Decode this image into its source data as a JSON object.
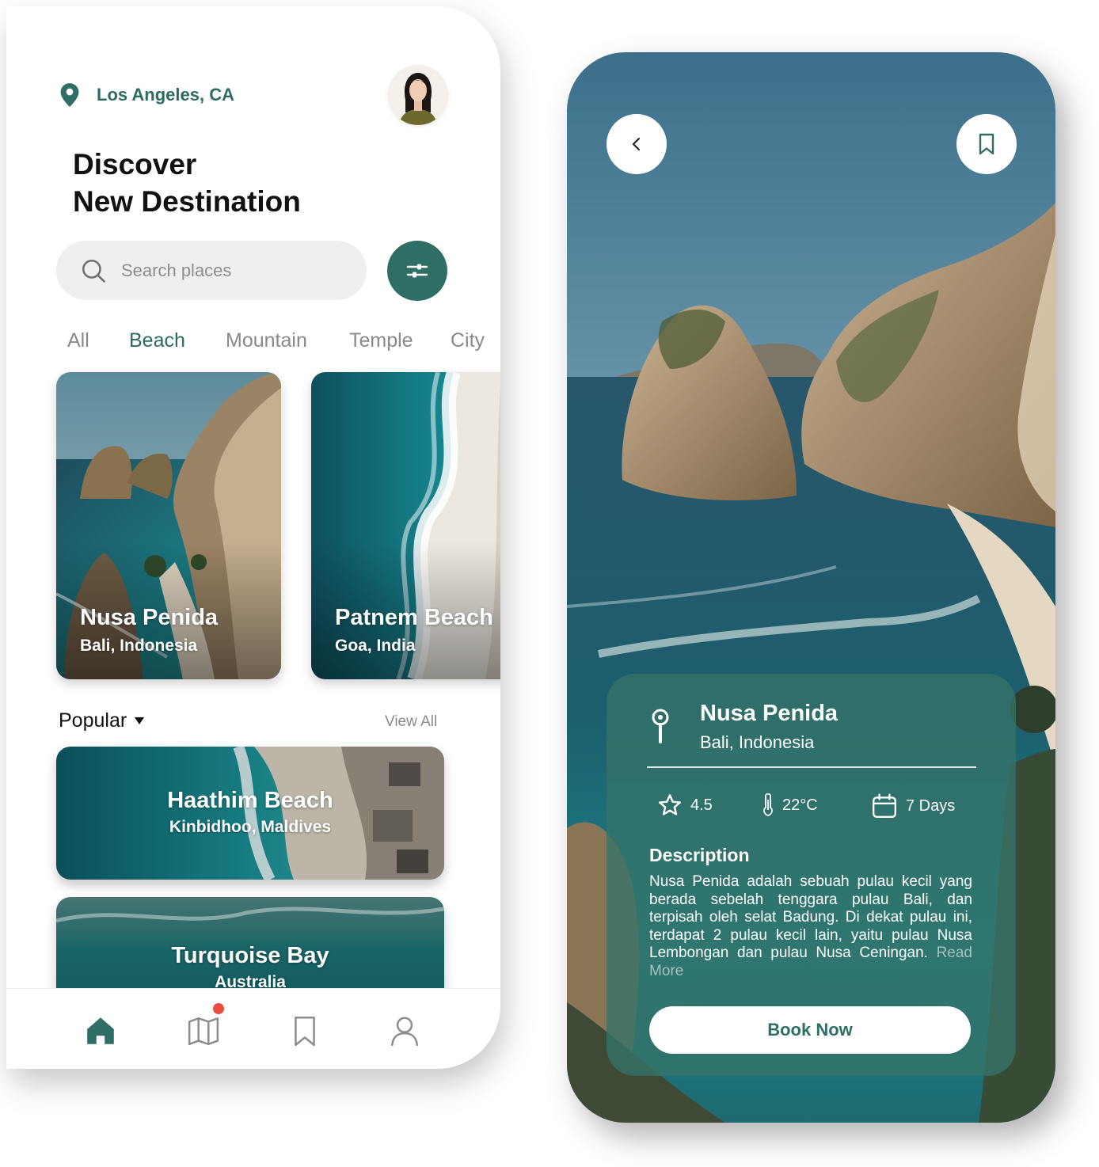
{
  "home": {
    "location": "Los Angeles, CA",
    "title_line1": "Discover",
    "title_line2": "New Destination",
    "search_placeholder": "Search places",
    "tabs": [
      {
        "label": "All",
        "active": false
      },
      {
        "label": "Beach",
        "active": true
      },
      {
        "label": "Mountain",
        "active": false
      },
      {
        "label": "Temple",
        "active": false
      },
      {
        "label": "City",
        "active": false
      }
    ],
    "featured": [
      {
        "name": "Nusa Penida",
        "location": "Bali, Indonesia"
      },
      {
        "name": "Patnem Beach",
        "location": "Goa, India"
      }
    ],
    "popular_label": "Popular",
    "view_all": "View All",
    "popular": [
      {
        "name": "Haathim Beach",
        "location": "Kinbidhoo, Maldives"
      },
      {
        "name": "Turquoise Bay",
        "location": "Australia"
      }
    ],
    "nav": [
      "home-icon",
      "map-icon",
      "bookmark-icon",
      "profile-icon"
    ]
  },
  "detail": {
    "name": "Nusa Penida",
    "location": "Bali, Indonesia",
    "rating": "4.5",
    "temperature": "22°C",
    "duration": "7 Days",
    "description_title": "Description",
    "description": "Nusa Penida adalah sebuah pulau kecil yang berada sebelah tenggara pulau Bali, dan terpisah oleh selat Badung. Di dekat pulau ini, terdapat 2 pulau kecil lain, yaitu pulau Nusa Lembongan dan pulau Nusa Ceningan.",
    "read_more": "Read More",
    "book_label": "Book Now"
  },
  "colors": {
    "primary": "#2e6e65",
    "primary_text": "#2c6b62",
    "notification": "#ec4b3f",
    "panel": "#357368"
  }
}
